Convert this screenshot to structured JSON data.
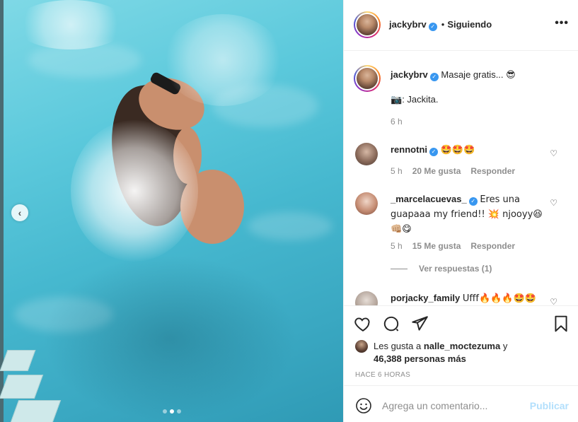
{
  "post": {
    "author": "jackybrv",
    "follow_state": "Siguiendo",
    "separator": "•",
    "more_icon": "more-horizontal-icon",
    "caption": {
      "username": "jackybrv",
      "text": "Masaje gratis...",
      "text_emoji": "😎",
      "credit_emoji": "📷",
      "credit": ": Jackita.",
      "time": "6 h"
    },
    "comments": [
      {
        "username": "rennotni",
        "verified": true,
        "text": "🤩🤩🤩",
        "time": "5 h",
        "likes": "20 Me gusta",
        "reply": "Responder"
      },
      {
        "username": "_marcelacuevas_",
        "verified": true,
        "text": "Eres una guapaaa my friend!! 💥 njooyy😆 👊🏼😋",
        "time": "5 h",
        "likes": "15 Me gusta",
        "reply": "Responder"
      },
      {
        "username": "porjacky_family",
        "verified": false,
        "text": "Ufff🔥🔥🔥🤩🤩"
      }
    ],
    "view_replies": "Ver respuestas (1)",
    "likes_prefix": "Les gusta a",
    "liked_by": "nalle_moctezuma",
    "likes_suffix_and": "y",
    "likes_others": "46,388 personas más",
    "time_ago": "HACE 6 HORAS",
    "comment_placeholder": "Agrega un comentario...",
    "publish_label": "Publicar"
  },
  "colors": {
    "verified_blue": "#3897f0",
    "publish_disabled": "#b2dffc",
    "meta_gray": "#8e8e8e",
    "pool_water": "#46b8cf"
  },
  "carousel": {
    "total_slides": 3,
    "active_slide": 2
  }
}
